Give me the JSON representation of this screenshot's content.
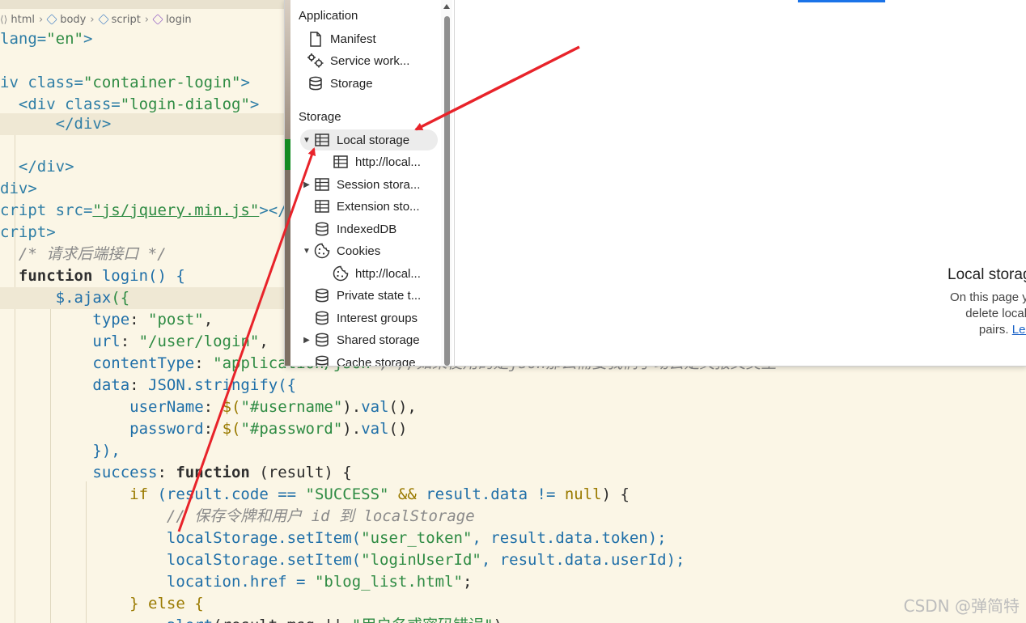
{
  "editor": {
    "breadcrumb": [
      "html",
      "body",
      "script",
      "login"
    ],
    "lines": {
      "l1": [
        "lang=",
        "\"en\"",
        ">"
      ],
      "l3": [
        "iv ",
        "class=",
        "\"container-login\"",
        ">"
      ],
      "l4": [
        "<div ",
        "class=",
        "\"login-dialog\"",
        ">"
      ],
      "l5": "</div>",
      "l7": "</div>",
      "l8": "div>",
      "l9": [
        "cript ",
        "src=",
        "\"js/jquery.min.js\"",
        "></sc"
      ],
      "l10": "cript>",
      "l11": "/* 请求后端接口 */",
      "l12": [
        "function ",
        "login",
        "() {"
      ],
      "l13": [
        "$.ajax",
        "({"
      ],
      "l14": [
        "type",
        ": ",
        "\"post\"",
        ","
      ],
      "l15": [
        "url",
        ": ",
        "\"/user/login\"",
        ","
      ],
      "l16": [
        "contentType",
        ": ",
        "\"application/json\"",
        ", //如果使用的是json那么需要我们手动去定义报文类型"
      ],
      "l17": [
        "data",
        ": ",
        "JSON.stringify",
        "({"
      ],
      "l18": [
        "userName",
        ": ",
        "$(",
        "\"#username\"",
        ").",
        "val",
        "(),"
      ],
      "l19": [
        "password",
        ": ",
        "$(",
        "\"#password\"",
        ").",
        "val",
        "()"
      ],
      "l20": "}),",
      "l21": [
        "success",
        ": ",
        "function ",
        "(result) {"
      ],
      "l22": [
        "if ",
        "(result.code == ",
        "\"SUCCESS\"",
        " && ",
        "result.data != ",
        "null",
        ") {"
      ],
      "l23": "// 保存令牌和用户 id 到 localStorage",
      "l24": [
        "localStorage.setItem(",
        "\"user_token\"",
        ", result.data.token);"
      ],
      "l25": [
        "localStorage.setItem(",
        "\"loginUserId\"",
        ", result.data.userId);"
      ],
      "l26": [
        "location.href = ",
        "\"blog_list.html\"",
        ";"
      ],
      "l27": [
        "} ",
        "else ",
        "{"
      ],
      "l28": [
        "alert",
        "(result.msg || ",
        "\"用户名或密码错误\"",
        ")"
      ]
    },
    "watermark": "CSDN @弹简特"
  },
  "devtools": {
    "sidebar": {
      "application_header": "Application",
      "application_items": [
        {
          "label": "Manifest",
          "icon": "file-icon"
        },
        {
          "label": "Service work...",
          "icon": "gears-icon"
        },
        {
          "label": "Storage",
          "icon": "database-icon"
        }
      ],
      "storage_header": "Storage",
      "local_storage": "Local storage",
      "local_storage_child": "http://local...",
      "session_storage": "Session stora...",
      "extension_storage": "Extension sto...",
      "indexeddb": "IndexedDB",
      "cookies": "Cookies",
      "cookies_child": "http://local...",
      "private_state": "Private state t...",
      "interest_groups": "Interest groups",
      "shared_storage": "Shared storage",
      "cache_storage": "Cache storage"
    },
    "main": {
      "empty_title": "Local storag",
      "empty_desc_1": "On this page you can view",
      "empty_desc_2": "delete local storage l",
      "empty_desc_3": "pairs. ",
      "learn_more": "Learn mo"
    }
  },
  "colors": {
    "arrow": "#e8232a",
    "selected_tab": "#1a73e8",
    "green_marker": "#138a22"
  }
}
